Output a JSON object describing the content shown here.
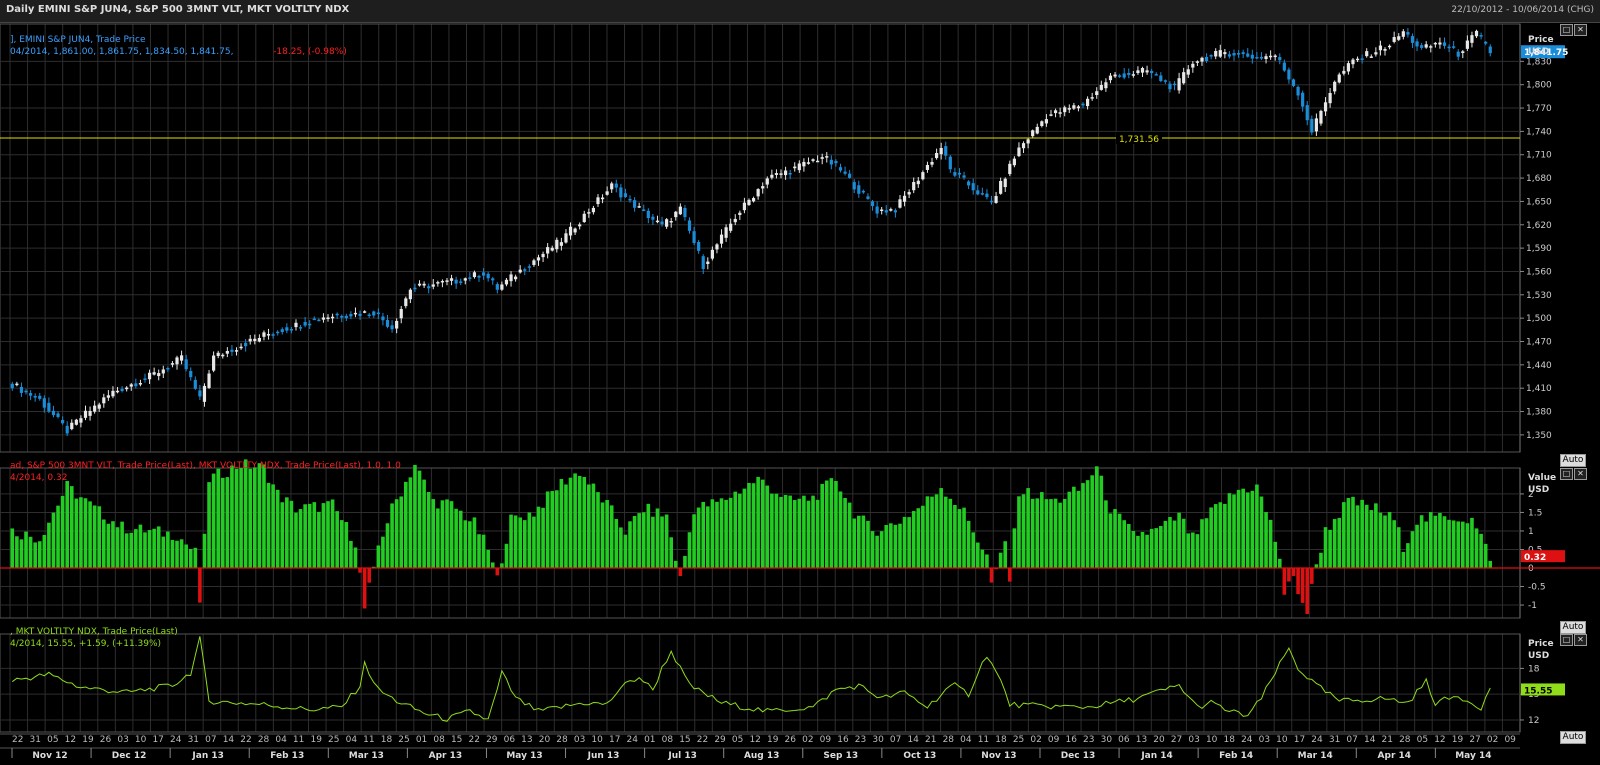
{
  "window": {
    "title": "Daily EMINI S&P JUN4, S&P 500 3MNT VLT, MKT VOLTLTY NDX",
    "date_range": "22/10/2012 - 10/06/2014 (CHG)"
  },
  "controls": {
    "auto_label": "Auto"
  },
  "chart_data": [
    {
      "type": "candlestick",
      "legend_line1": "], EMINI S&P JUN4, Trade Price",
      "legend_line2_prefix": "04/2014, 1,861.00, 1,861.75, 1,834.50, 1,841.75,",
      "legend_line2_change": "-18.25, (-0.98%)",
      "axis_title": "Price",
      "axis_unit": "USD",
      "yticks": [
        1350,
        1380,
        1410,
        1440,
        1470,
        1500,
        1530,
        1560,
        1590,
        1620,
        1650,
        1680,
        1710,
        1740,
        1770,
        1800,
        1830
      ],
      "ylim": [
        1328,
        1878
      ],
      "last_value_label": "1,841.75",
      "last_value": 1841.75,
      "hline_value": 1731.56,
      "hline_label": "1,731.56",
      "anchors": [
        [
          0,
          1415
        ],
        [
          6,
          1395
        ],
        [
          12,
          1355
        ],
        [
          15,
          1372
        ],
        [
          22,
          1405
        ],
        [
          30,
          1425
        ],
        [
          37,
          1448
        ],
        [
          41,
          1395
        ],
        [
          44,
          1450
        ],
        [
          55,
          1478
        ],
        [
          68,
          1502
        ],
        [
          79,
          1508
        ],
        [
          83,
          1488
        ],
        [
          87,
          1538
        ],
        [
          97,
          1548
        ],
        [
          103,
          1558
        ],
        [
          106,
          1538
        ],
        [
          113,
          1570
        ],
        [
          120,
          1600
        ],
        [
          131,
          1670
        ],
        [
          135,
          1650
        ],
        [
          142,
          1618
        ],
        [
          146,
          1640
        ],
        [
          151,
          1568
        ],
        [
          158,
          1630
        ],
        [
          165,
          1680
        ],
        [
          170,
          1690
        ],
        [
          177,
          1708
        ],
        [
          181,
          1690
        ],
        [
          189,
          1638
        ],
        [
          193,
          1640
        ],
        [
          199,
          1688
        ],
        [
          203,
          1720
        ],
        [
          205,
          1690
        ],
        [
          214,
          1648
        ],
        [
          220,
          1718
        ],
        [
          226,
          1760
        ],
        [
          234,
          1775
        ],
        [
          240,
          1810
        ],
        [
          248,
          1818
        ],
        [
          254,
          1795
        ],
        [
          258,
          1830
        ],
        [
          265,
          1842
        ],
        [
          272,
          1835
        ],
        [
          276,
          1838
        ],
        [
          281,
          1790
        ],
        [
          284,
          1740
        ],
        [
          289,
          1805
        ],
        [
          293,
          1830
        ],
        [
          301,
          1852
        ],
        [
          304,
          1868
        ],
        [
          308,
          1845
        ],
        [
          312,
          1855
        ],
        [
          316,
          1840
        ],
        [
          320,
          1866
        ],
        [
          323,
          1842
        ]
      ]
    },
    {
      "type": "bar",
      "legend_line1": "ad, S&P 500 3MNT VLT, Trade Price(Last), MKT VOLTLTY NDX, Trade Price(Last), 1.0, 1.0",
      "legend_line2": "4/2014, 0.32",
      "axis_title": "Value",
      "axis_unit": "USD",
      "yticks": [
        -1,
        -0.5,
        0,
        0.5,
        1,
        1.5,
        2
      ],
      "ytick_labels": [
        "-1",
        "-0.5",
        "0",
        "0.5",
        "1",
        "1.5",
        "2"
      ],
      "ylim": [
        -1.35,
        2.7
      ],
      "last_value_label": "0.32",
      "anchors": [
        [
          0,
          1.0
        ],
        [
          6,
          0.8
        ],
        [
          12,
          2.2
        ],
        [
          18,
          1.6
        ],
        [
          24,
          1.1
        ],
        [
          30,
          1.0
        ],
        [
          36,
          0.9
        ],
        [
          40,
          0.4
        ],
        [
          41,
          -0.9
        ],
        [
          43,
          2.4
        ],
        [
          50,
          2.8
        ],
        [
          55,
          2.7
        ],
        [
          58,
          2.0
        ],
        [
          62,
          1.6
        ],
        [
          70,
          1.7
        ],
        [
          75,
          0.7
        ],
        [
          77,
          -1.1
        ],
        [
          80,
          0.6
        ],
        [
          83,
          1.6
        ],
        [
          88,
          2.8
        ],
        [
          92,
          1.8
        ],
        [
          96,
          1.7
        ],
        [
          101,
          1.2
        ],
        [
          104,
          0.5
        ],
        [
          106,
          -0.2
        ],
        [
          109,
          1.3
        ],
        [
          114,
          1.5
        ],
        [
          120,
          2.3
        ],
        [
          124,
          2.6
        ],
        [
          130,
          1.7
        ],
        [
          134,
          1.0
        ],
        [
          138,
          1.6
        ],
        [
          143,
          1.4
        ],
        [
          146,
          -0.3
        ],
        [
          149,
          1.6
        ],
        [
          155,
          1.8
        ],
        [
          163,
          2.4
        ],
        [
          170,
          1.8
        ],
        [
          175,
          1.9
        ],
        [
          180,
          2.4
        ],
        [
          184,
          1.5
        ],
        [
          188,
          1.0
        ],
        [
          193,
          1.2
        ],
        [
          199,
          1.7
        ],
        [
          203,
          2.2
        ],
        [
          208,
          1.5
        ],
        [
          213,
          0.3
        ],
        [
          214,
          -0.4
        ],
        [
          217,
          0.7
        ],
        [
          218,
          -0.3
        ],
        [
          220,
          2.1
        ],
        [
          228,
          1.8
        ],
        [
          233,
          2.1
        ],
        [
          237,
          2.7
        ],
        [
          240,
          1.6
        ],
        [
          245,
          0.9
        ],
        [
          250,
          1.0
        ],
        [
          255,
          1.4
        ],
        [
          258,
          0.8
        ],
        [
          262,
          1.5
        ],
        [
          268,
          2.1
        ],
        [
          272,
          2.2
        ],
        [
          275,
          1.2
        ],
        [
          277,
          0.3
        ],
        [
          278,
          -0.7
        ],
        [
          280,
          -0.3
        ],
        [
          283,
          -1.2
        ],
        [
          285,
          0.1
        ],
        [
          287,
          1.0
        ],
        [
          292,
          1.8
        ],
        [
          298,
          1.6
        ],
        [
          302,
          1.3
        ],
        [
          304,
          0.6
        ],
        [
          307,
          1.3
        ],
        [
          314,
          1.4
        ],
        [
          319,
          1.3
        ],
        [
          323,
          0.32
        ]
      ]
    },
    {
      "type": "line",
      "legend_line1": ", MKT VOLTLTY NDX, Trade Price(Last)",
      "legend_line2": "4/2014, 15.55, +1.59, (+11.39%)",
      "axis_title": "Price",
      "axis_unit": "USD",
      "yticks": [
        12,
        15,
        18
      ],
      "ytick_labels": [
        "12",
        "15",
        "18"
      ],
      "ylim": [
        10.6,
        22.0
      ],
      "last_value_label": "15.55",
      "anchors": [
        [
          0,
          16.6
        ],
        [
          8,
          17.3
        ],
        [
          15,
          15.8
        ],
        [
          25,
          15.2
        ],
        [
          35,
          16.0
        ],
        [
          39,
          17.5
        ],
        [
          41,
          21.4
        ],
        [
          43,
          14.2
        ],
        [
          55,
          13.8
        ],
        [
          65,
          13.2
        ],
        [
          72,
          13.5
        ],
        [
          76,
          16.0
        ],
        [
          77,
          18.5
        ],
        [
          80,
          15.5
        ],
        [
          84,
          14.2
        ],
        [
          90,
          12.8
        ],
        [
          95,
          12.1
        ],
        [
          100,
          13.0
        ],
        [
          104,
          12.0
        ],
        [
          106,
          15.5
        ],
        [
          107,
          17.5
        ],
        [
          110,
          14.5
        ],
        [
          115,
          13.0
        ],
        [
          120,
          13.5
        ],
        [
          125,
          14.0
        ],
        [
          130,
          13.8
        ],
        [
          133,
          15.8
        ],
        [
          137,
          17.0
        ],
        [
          140,
          15.5
        ],
        [
          142,
          18.0
        ],
        [
          144,
          20.0
        ],
        [
          148,
          16.0
        ],
        [
          155,
          14.0
        ],
        [
          165,
          13.0
        ],
        [
          175,
          13.5
        ],
        [
          180,
          15.5
        ],
        [
          185,
          16.0
        ],
        [
          190,
          14.5
        ],
        [
          195,
          15.2
        ],
        [
          200,
          13.5
        ],
        [
          204,
          15.5
        ],
        [
          206,
          16.0
        ],
        [
          209,
          15.0
        ],
        [
          211,
          17.5
        ],
        [
          213,
          19.6
        ],
        [
          216,
          16.5
        ],
        [
          218,
          13.8
        ],
        [
          225,
          13.6
        ],
        [
          235,
          13.5
        ],
        [
          245,
          14.4
        ],
        [
          255,
          16.0
        ],
        [
          259,
          13.5
        ],
        [
          262,
          14.0
        ],
        [
          266,
          13.0
        ],
        [
          270,
          12.5
        ],
        [
          273,
          14.5
        ],
        [
          276,
          17.5
        ],
        [
          279,
          20.3
        ],
        [
          281,
          18.0
        ],
        [
          285,
          16.0
        ],
        [
          290,
          14.2
        ],
        [
          300,
          14.5
        ],
        [
          305,
          14.0
        ],
        [
          309,
          16.5
        ],
        [
          311,
          14.0
        ],
        [
          316,
          14.8
        ],
        [
          319,
          14.0
        ],
        [
          321,
          13.5
        ],
        [
          323,
          15.55
        ]
      ]
    }
  ],
  "x_axis": {
    "day_labels": [
      "22",
      "31",
      "05",
      "12",
      "19",
      "26",
      "03",
      "10",
      "17",
      "24",
      "31",
      "07",
      "14",
      "22",
      "28",
      "04",
      "11",
      "19",
      "25",
      "04",
      "11",
      "18",
      "25",
      "01",
      "08",
      "15",
      "22",
      "29",
      "06",
      "13",
      "20",
      "28",
      "03",
      "10",
      "17",
      "24",
      "01",
      "08",
      "15",
      "22",
      "29",
      "05",
      "12",
      "19",
      "26",
      "02",
      "09",
      "16",
      "23",
      "30",
      "07",
      "14",
      "21",
      "28",
      "04",
      "11",
      "18",
      "25",
      "02",
      "09",
      "16",
      "23",
      "30",
      "06",
      "13",
      "20",
      "27",
      "03",
      "10",
      "18",
      "24",
      "03",
      "10",
      "17",
      "24",
      "31",
      "07",
      "14",
      "21",
      "28",
      "05",
      "12",
      "19",
      "27",
      "02",
      "09"
    ],
    "month_labels": [
      "Nov 12",
      "Dec 12",
      "Jan 13",
      "Feb 13",
      "Mar 13",
      "Apr 13",
      "May 13",
      "Jun 13",
      "Jul 13",
      "Aug 13",
      "Sep 13",
      "Oct 13",
      "Nov 13",
      "Dec 13",
      "Jan 14",
      "Feb 14",
      "Mar 14",
      "Apr 14",
      "May 14"
    ]
  }
}
